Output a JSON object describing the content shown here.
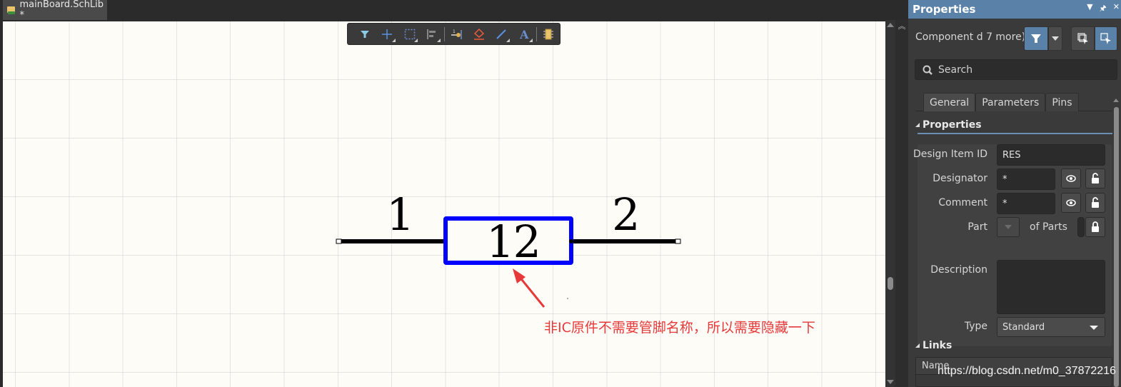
{
  "document_tab": {
    "title": "mainBoard.SchLib *",
    "icon": "schlib-file-icon"
  },
  "toolbar": {
    "items": [
      {
        "name": "filter",
        "icon": "filter-icon",
        "has_submenu": false
      },
      {
        "name": "place-cross",
        "icon": "crosshair-icon",
        "has_submenu": true
      },
      {
        "name": "select-area",
        "icon": "selection-rect-icon",
        "has_submenu": true
      },
      {
        "name": "align",
        "icon": "align-icon",
        "has_submenu": true
      },
      {
        "name": "place-pin",
        "icon": "pin-icon",
        "has_submenu": false
      },
      {
        "name": "place-ieee",
        "icon": "ieee-symbol-icon",
        "has_submenu": false
      },
      {
        "name": "place-line",
        "icon": "line-icon",
        "has_submenu": true
      },
      {
        "name": "place-text",
        "icon": "text-icon",
        "has_submenu": true
      },
      {
        "name": "place-part",
        "icon": "component-icon",
        "has_submenu": false
      }
    ]
  },
  "schematic": {
    "pin_left_number": "1",
    "pin_right_number": "2",
    "body_label": "12",
    "body_color": "#0000ff",
    "annotation": "非IC原件不需要管脚名称，所以需要隐藏一下",
    "annotation_color": "#e8393a"
  },
  "panel": {
    "title": "Properties",
    "header_icons": [
      "dropdown-icon",
      "pin-icon",
      "close-icon"
    ],
    "selection_label": "Component   d 7 more)",
    "search_placeholder": "Search",
    "tabs": [
      {
        "label": "General",
        "active": true
      },
      {
        "label": "Parameters",
        "active": false
      },
      {
        "label": "Pins",
        "active": false
      }
    ],
    "properties_section": "Properties",
    "fields": {
      "design_item_id": {
        "label": "Design Item ID",
        "value": "RES"
      },
      "designator": {
        "label": "Designator",
        "value": "*"
      },
      "comment": {
        "label": "Comment",
        "value": "*"
      },
      "part": {
        "label": "Part",
        "value": "",
        "of_parts_label": "of Parts"
      },
      "description": {
        "label": "Description",
        "value": ""
      },
      "type": {
        "label": "Type",
        "value": "Standard"
      }
    },
    "links_section": "Links",
    "links_columns": [
      "Name"
    ]
  },
  "accent_color": "#5a82a8",
  "watermark": "https://blog.csdn.net/m0_37872216"
}
